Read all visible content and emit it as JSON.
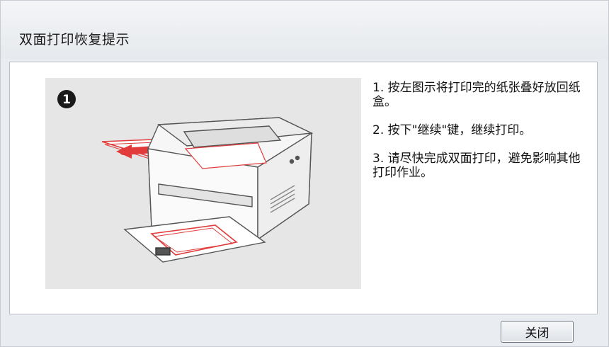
{
  "dialog": {
    "title": "双面打印恢复提示",
    "step_badge": "1",
    "steps": [
      "1. 按左图示将打印完的纸张叠好放回纸盒。",
      "2. 按下\"继续\"键，继续打印。",
      "3. 请尽快完成双面打印，避免影响其他打印作业。"
    ],
    "close_label": "关闭"
  },
  "colors": {
    "accent_red": "#e23b3b",
    "illustration_bg": "#e6e6e6"
  }
}
